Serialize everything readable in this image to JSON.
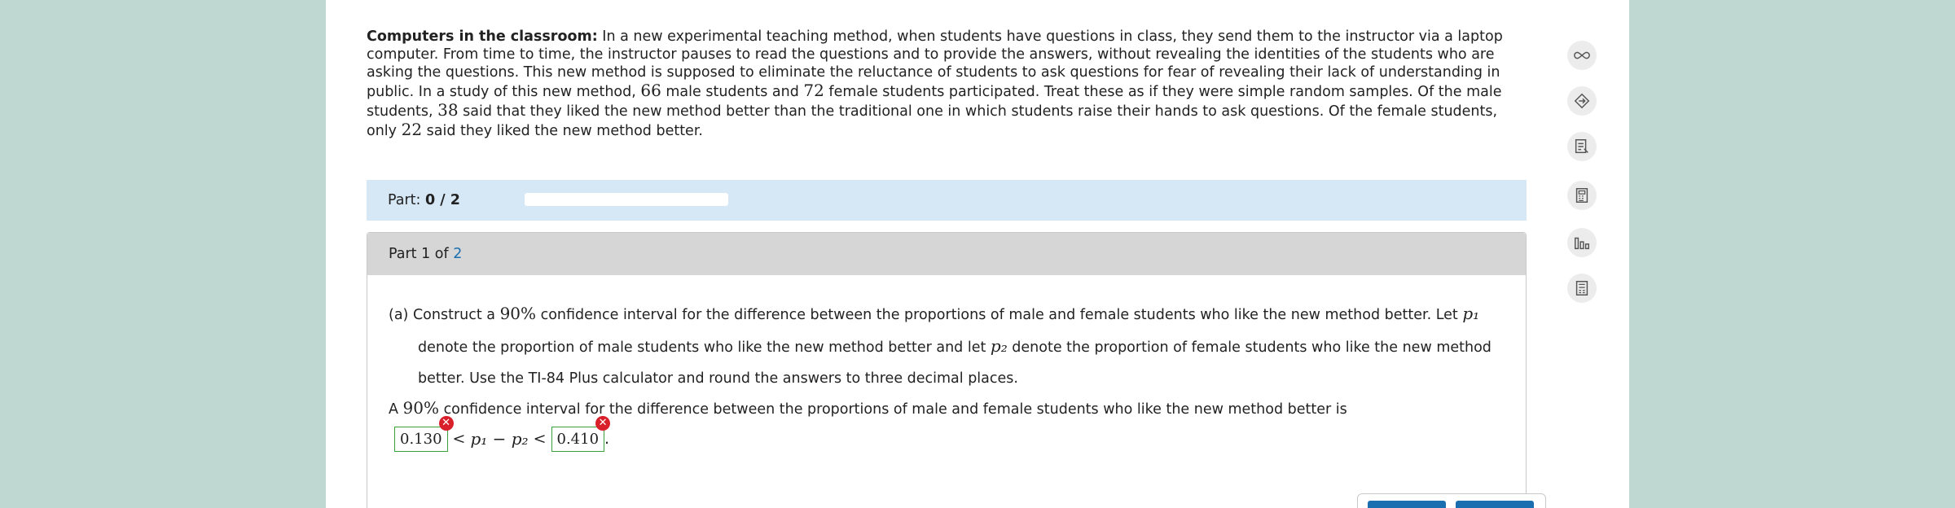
{
  "problem": {
    "heading": "Computers in the classroom:",
    "body": " In a new experimental teaching method, when students have questions in class, they send them to the instructor via a laptop computer. From time to time, the instructor pauses to read the questions and to provide the answers, without revealing the identities of the students who are asking the questions. This new method is supposed to eliminate the reluctance of students to ask questions for fear of revealing their lack of understanding in public. In a study of this new method, ",
    "male_n": "66",
    "mid1": " male students and ",
    "female_n": "72",
    "mid2": " female students participated. Treat these as if they were simple random samples. Of the male students, ",
    "male_like": "38",
    "mid3": " said that they liked the new method better than the traditional one in which students raise their hands to ask questions. Of the female students, only ",
    "female_like": "22",
    "mid4": " said they liked the new method better."
  },
  "part_bar": {
    "label_prefix": "Part: ",
    "label_value": "0 / 2",
    "progress": 0
  },
  "card": {
    "head_prefix": "Part 1 of ",
    "head_total": "2",
    "q_a": "(a) Construct a ",
    "q_conf": "90%",
    "q_b": " confidence interval for the difference between the proportions of male and female students who like the new method better. Let ",
    "q_p1": "p₁",
    "q_c": "denote the proportion of male students who like the new method better and let ",
    "q_p2": "p₂",
    "q_d": " denote the proportion of female students who like the new method",
    "q_e": "better. Use the TI-84 Plus calculator and round the answers to three decimal places.",
    "ans_a": "A ",
    "ans_conf": "90%",
    "ans_b": " confidence interval for the difference between the proportions of male and female students who like the new method better is",
    "lower": "0.130",
    "upper": "0.410",
    "lt": "<",
    "middle": "p₁ − p₂",
    "period": "."
  },
  "side_icons": [
    "infinity-icon",
    "tag-icon",
    "notes-icon",
    "calculator-icon",
    "bar-chart-icon",
    "data-table-icon"
  ],
  "colors": {
    "background": "#c0d8d2",
    "part_bar": "#d6e7f5",
    "card_head": "#d6d6d6",
    "accent": "#1a6fb0",
    "error": "#d9202a",
    "answer_border": "#3aa03a"
  }
}
